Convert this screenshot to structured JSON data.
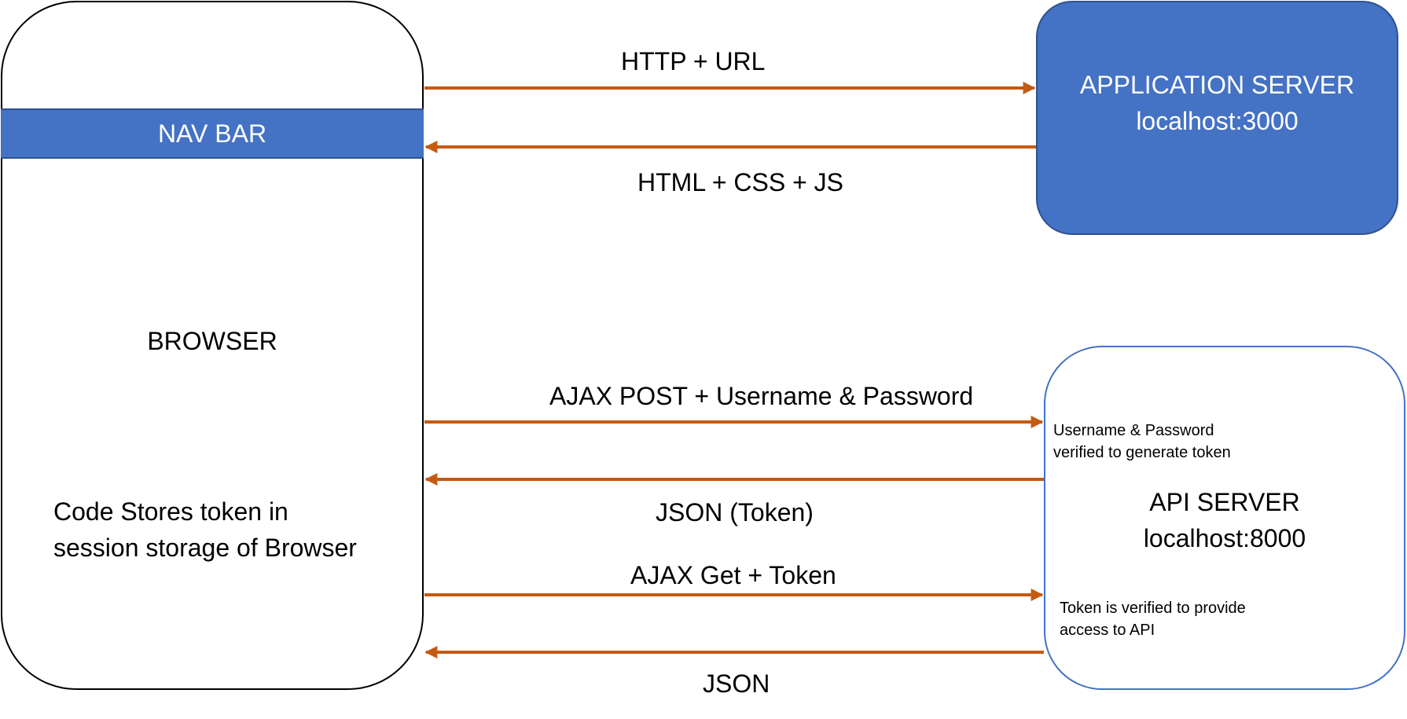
{
  "colors": {
    "box_fill": "#4472C4",
    "box_border": "#2F528F",
    "arrow": "#C55A11",
    "text_on_fill": "#FFFFFF"
  },
  "browser": {
    "nav_bar": "NAV BAR",
    "label": "BROWSER",
    "note_line1": "Code Stores token in",
    "note_line2": "session storage of Browser"
  },
  "application_server": {
    "line1": "APPLICATION SERVER",
    "line2": "localhost:3000"
  },
  "api_server": {
    "line1": "API SERVER",
    "line2": "localhost:8000",
    "note_top_line1": "Username & Password",
    "note_top_line2": "verified to generate token",
    "note_bottom_line1": "Token is verified to provide",
    "note_bottom_line2": "access to API"
  },
  "flows": [
    {
      "label": "HTTP + URL",
      "from": "BROWSER",
      "to": "APPLICATION SERVER"
    },
    {
      "label": "HTML + CSS + JS",
      "from": "APPLICATION SERVER",
      "to": "BROWSER"
    },
    {
      "label": "AJAX POST + Username & Password",
      "from": "BROWSER",
      "to": "API SERVER"
    },
    {
      "label": "JSON (Token)",
      "from": "API SERVER",
      "to": "BROWSER"
    },
    {
      "label": "AJAX Get + Token",
      "from": "BROWSER",
      "to": "API SERVER"
    },
    {
      "label": "JSON",
      "from": "API SERVER",
      "to": "BROWSER"
    }
  ]
}
